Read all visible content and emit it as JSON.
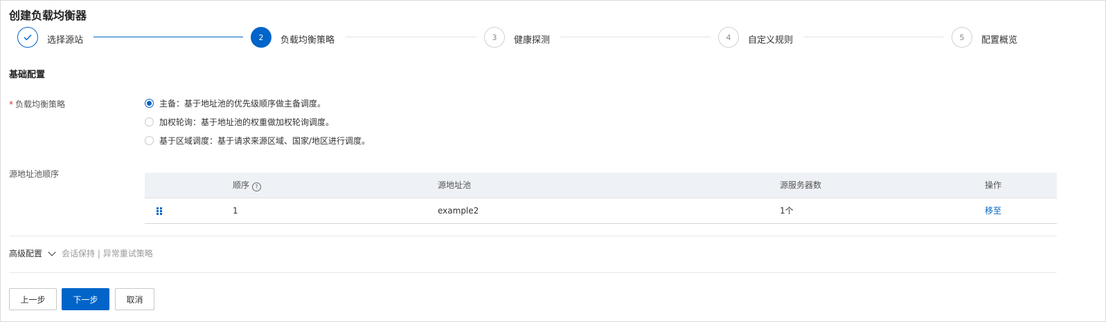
{
  "page": {
    "title": "创建负载均衡器"
  },
  "steps": [
    {
      "number": "",
      "label": "选择源站",
      "state": "done",
      "icon": "check-icon"
    },
    {
      "number": "2",
      "label": "负载均衡策略",
      "state": "active"
    },
    {
      "number": "3",
      "label": "健康探测",
      "state": "pending"
    },
    {
      "number": "4",
      "label": "自定义规则",
      "state": "pending"
    },
    {
      "number": "5",
      "label": "配置概览",
      "state": "pending"
    }
  ],
  "basic": {
    "section_title": "基础配置",
    "strategy": {
      "label": "负载均衡策略",
      "required_mark": "*",
      "options": [
        {
          "text": "主备：基于地址池的优先级顺序做主备调度。",
          "checked": true
        },
        {
          "text": "加权轮询：基于地址池的权重做加权轮询调度。",
          "checked": false
        },
        {
          "text": "基于区域调度：基于请求来源区域、国家/地区进行调度。",
          "checked": false
        }
      ]
    },
    "pool_order": {
      "label": "源地址池顺序",
      "columns": {
        "order": "顺序",
        "pool": "源地址池",
        "servers": "源服务器数",
        "action": "操作"
      },
      "help_icon": "question-circle-icon",
      "rows": [
        {
          "order": "1",
          "pool": "example2",
          "servers": "1个",
          "action": "移至",
          "drag_icon": "drag-handle-icon"
        }
      ]
    }
  },
  "advanced": {
    "label": "高级配置",
    "summary": "会话保持 | 异常重试策略",
    "icon": "chevron-down-icon"
  },
  "footer": {
    "prev": "上一步",
    "next": "下一步",
    "cancel": "取消"
  },
  "colors": {
    "accent": "#0064c8",
    "required": "#d93026",
    "header_bg": "#eef1f5"
  }
}
